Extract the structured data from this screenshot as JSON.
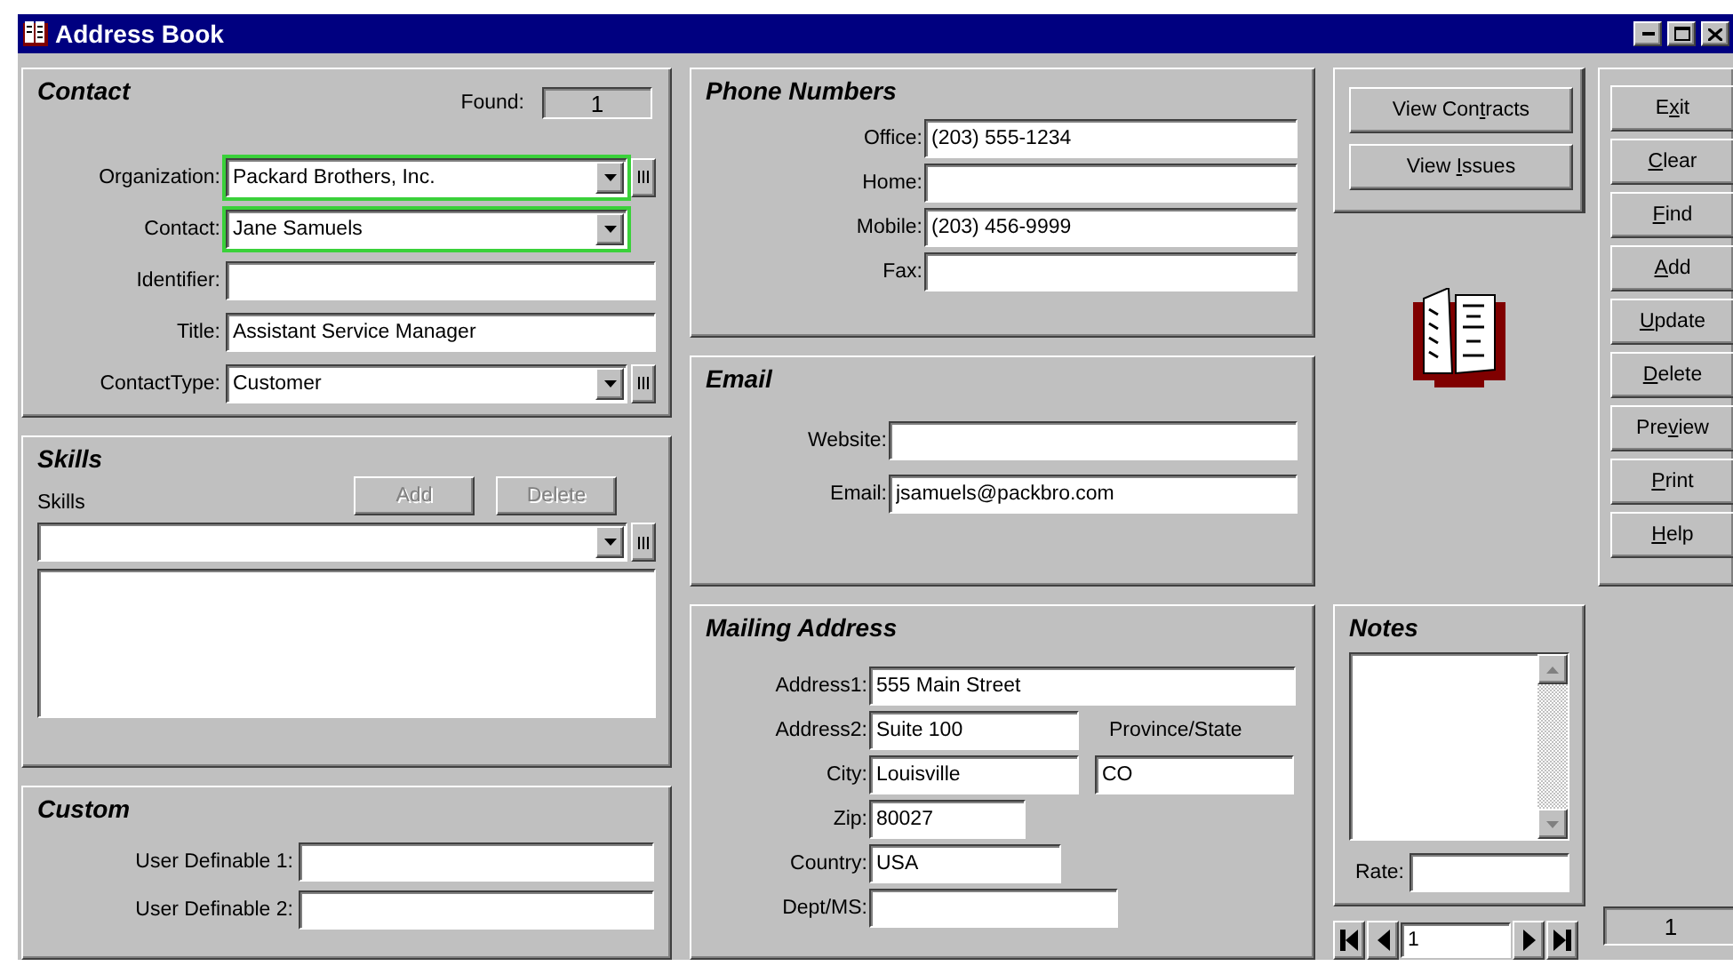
{
  "window": {
    "title": "Address Book"
  },
  "contact": {
    "heading": "Contact",
    "found_label": "Found:",
    "found": "1",
    "fields": [
      {
        "label": "Organization:",
        "value": "Packard Brothers, Inc.",
        "kind": "dropdown",
        "lookup": true,
        "highlighted": true
      },
      {
        "label": "Contact:",
        "value": "Jane Samuels",
        "kind": "dropdown",
        "lookup": false,
        "highlighted": true
      },
      {
        "label": "Identifier:",
        "kind": "text",
        "lookup": false,
        "highlighted": false
      },
      {
        "label": "Title:",
        "value": "Assistant Service Manager",
        "kind": "text",
        "lookup": false,
        "highlighted": false
      },
      {
        "label": "ContactType:",
        "value": "Customer",
        "kind": "dropdown",
        "lookup": true,
        "highlighted": false
      }
    ]
  },
  "skills": {
    "heading": "Skills",
    "label": "Skills",
    "buttons": [
      {
        "label": "Add",
        "disabled": true
      },
      {
        "label": "Delete",
        "disabled": true
      }
    ]
  },
  "custom": {
    "heading": "Custom",
    "fields": [
      {
        "label": "User Definable 1:"
      },
      {
        "label": "User Definable 2:"
      }
    ]
  },
  "phone": {
    "heading": "Phone Numbers",
    "fields": [
      {
        "label": "Office:",
        "value": "(203) 555-1234"
      },
      {
        "label": "Home:"
      },
      {
        "label": "Mobile:",
        "value": "(203) 456-9999"
      },
      {
        "label": "Fax:"
      }
    ]
  },
  "email": {
    "heading": "Email",
    "fields": [
      {
        "label": "Website:"
      },
      {
        "label": "Email:",
        "value": "jsamuels@packbro.com"
      }
    ]
  },
  "mailing": {
    "heading": "Mailing Address",
    "fields": [
      {
        "label": "Address1:",
        "value": "555 Main Street"
      },
      {
        "label": "Address2:",
        "value": "Suite 100"
      },
      {
        "label": "City:",
        "value": "Louisville"
      },
      {
        "label": "Zip:",
        "value": "80027"
      },
      {
        "label": "Country:",
        "value": "USA"
      },
      {
        "label": "Dept/MS:"
      }
    ],
    "state_label": "Province/State",
    "state_value": "CO"
  },
  "view_buttons": [
    {
      "pre": "View Con",
      "key": "t",
      "post": "racts"
    },
    {
      "pre": "View ",
      "key": "I",
      "post": "ssues"
    }
  ],
  "notes": {
    "heading": "Notes",
    "rate_label": "Rate:"
  },
  "navigator": {
    "record": "1",
    "total": "1"
  },
  "actions": [
    {
      "pre": "E",
      "key": "x",
      "post": "it"
    },
    {
      "key": "C",
      "post": "lear"
    },
    {
      "key": "F",
      "post": "ind"
    },
    {
      "key": "A",
      "post": "dd"
    },
    {
      "key": "U",
      "post": "pdate"
    },
    {
      "key": "D",
      "post": "elete"
    },
    {
      "pre": "Pre",
      "key": "v",
      "post": "iew"
    },
    {
      "key": "P",
      "post": "rint"
    },
    {
      "key": "H",
      "post": "elp"
    }
  ]
}
